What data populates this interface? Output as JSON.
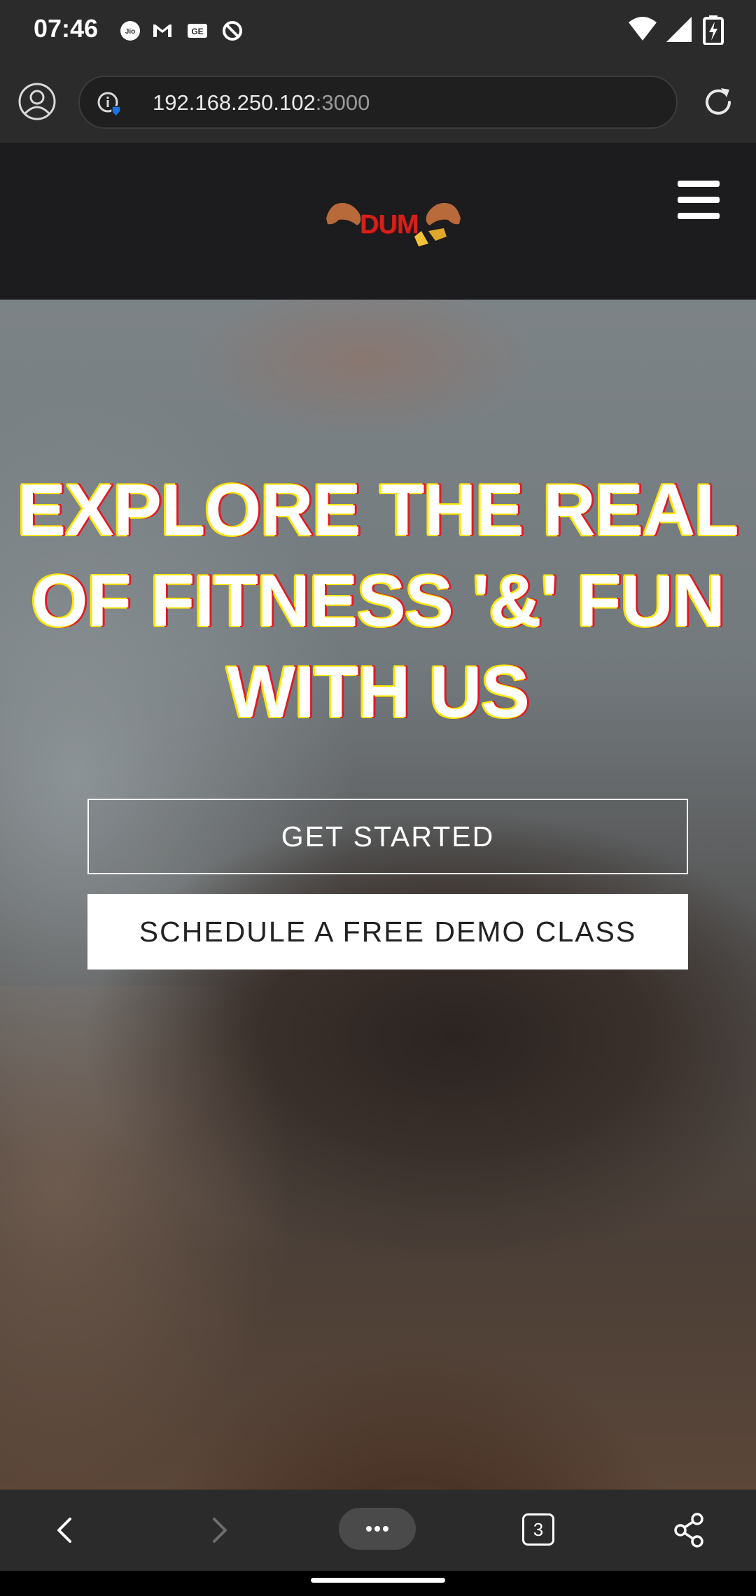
{
  "status_bar": {
    "time": "07:46",
    "notification_icons": [
      "jio-icon",
      "gmail-icon",
      "news-icon",
      "at-sign-icon"
    ],
    "system_icons": [
      "wifi-icon",
      "cell-signal-icon",
      "battery-charging-icon"
    ]
  },
  "browser": {
    "url_host": "192.168.250.102",
    "url_port": ":3000",
    "open_tabs_count": "3",
    "menu_label": "•••"
  },
  "site": {
    "logo_text": "DUM",
    "hero_headline_lines": [
      "EXPLORE THE REAL",
      "OF FITNESS '&' FUN",
      "WITH US"
    ],
    "get_started_label": "GET STARTED",
    "demo_class_label": "SCHEDULE A FREE DEMO CLASS"
  },
  "colors": {
    "status_bar_bg": "#2b2b2b",
    "header_bg": "#1c1b1d",
    "logo_red": "#d4211c",
    "headline_outline_yellow": "#ffe600",
    "headline_outline_red": "#e01b24"
  }
}
